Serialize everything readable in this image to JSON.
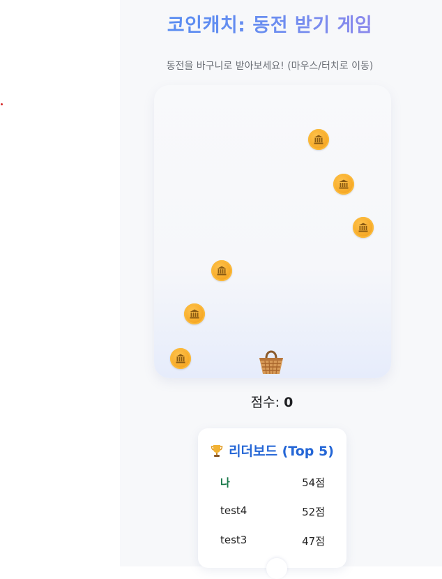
{
  "header": {
    "title": "코인캐치: 동전 받기 게임",
    "subtitle": "동전을 바구니로 받아보세요! (마우스/터치로 이동)"
  },
  "game": {
    "coin_icon": "bank-icon",
    "basket_icon": "basket-icon",
    "colors": {
      "coin": "#f5a623",
      "title_start": "#4f8bf2",
      "title_end": "#9a86ea"
    }
  },
  "score": {
    "label": "점수:",
    "value": "0"
  },
  "leaderboard": {
    "title": "리더보드 (Top 5)",
    "icon": "trophy-icon",
    "rows": [
      {
        "name": "나",
        "points": "54점"
      },
      {
        "name": "test4",
        "points": "52점"
      },
      {
        "name": "test3",
        "points": "47점"
      }
    ]
  }
}
